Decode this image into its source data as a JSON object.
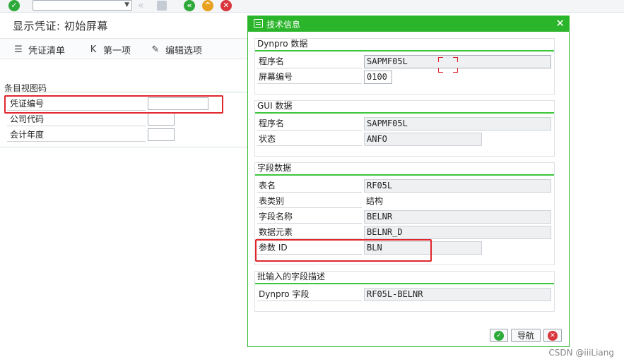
{
  "window": {
    "title": "显示凭证: 初始屏幕"
  },
  "toolbar": {
    "command_field_value": "",
    "icons": [
      "enter-icon",
      "back-icon",
      "save-icon",
      "green-back-icon",
      "exit-icon",
      "cancel-icon",
      "print-icon",
      "find-icon",
      "find-next-icon",
      "first-page-icon",
      "prev-page-icon",
      "next-page-icon",
      "last-page-icon",
      "create-session-icon",
      "shortcut-icon",
      "help-icon",
      "settings-icon"
    ]
  },
  "app_toolbar": {
    "doc_list": "凭证清单",
    "first_item": "第一项",
    "edit_options": "编辑选项"
  },
  "background_form": {
    "group_title": "条目视图码",
    "fields": [
      {
        "label": "凭证编号",
        "value": ""
      },
      {
        "label": "公司代码",
        "value": ""
      },
      {
        "label": "会计年度",
        "value": ""
      }
    ]
  },
  "dialog": {
    "title": "技术信息",
    "dynpro": {
      "title": "Dynpro 数据",
      "program_label": "程序名",
      "program_value": "SAPMF05L",
      "screen_label": "屏幕编号",
      "screen_value": "0100"
    },
    "gui": {
      "title": "GUI 数据",
      "program_label": "程序名",
      "program_value": "SAPMF05L",
      "status_label": "状态",
      "status_value": "ANFO"
    },
    "field": {
      "title": "字段数据",
      "table_label": "表名",
      "table_value": "RF05L",
      "table_type_label": "表类别",
      "table_type_value": "结构",
      "field_name_label": "字段名称",
      "field_name_value": "BELNR",
      "data_element_label": "数据元素",
      "data_element_value": "BELNR_D",
      "param_id_label": "参数 ID",
      "param_id_value": "BLN"
    },
    "batch": {
      "title": "批输入的字段描述",
      "dynpro_field_label": "Dynpro 字段",
      "dynpro_field_value": "RF05L-BELNR"
    },
    "buttons": {
      "navigate": "导航"
    }
  },
  "watermark": "CSDN @iiiLiang",
  "colors": {
    "header_green": "#2bb52b",
    "highlight_red": "#e0262c",
    "group_line_green": "#3cc63c"
  }
}
